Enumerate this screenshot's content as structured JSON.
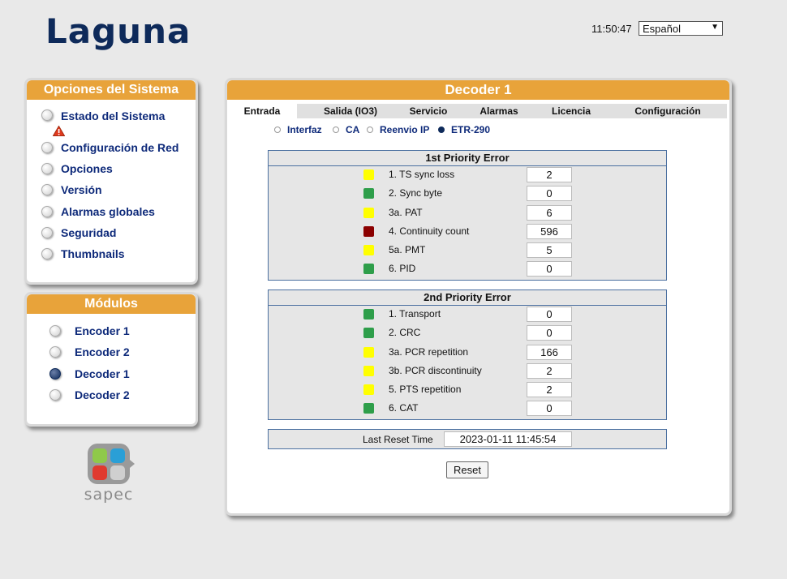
{
  "header": {
    "brand": "Laguna",
    "clock": "11:50:47",
    "language": "Español"
  },
  "system_panel": {
    "title": "Opciones del Sistema",
    "items": [
      {
        "label": "Estado del Sistema",
        "warning": true
      },
      {
        "label": "Configuración de Red"
      },
      {
        "label": "Opciones"
      },
      {
        "label": "Versión"
      },
      {
        "label": "Alarmas globales"
      },
      {
        "label": "Seguridad"
      },
      {
        "label": "Thumbnails"
      }
    ]
  },
  "modules_panel": {
    "title": "Módulos",
    "items": [
      {
        "label": "Encoder 1",
        "selected": false
      },
      {
        "label": "Encoder 2",
        "selected": false
      },
      {
        "label": "Decoder 1",
        "selected": true
      },
      {
        "label": "Decoder 2",
        "selected": false
      }
    ]
  },
  "main": {
    "title": "Decoder 1",
    "tabs": [
      "Entrada",
      "Salida (IO3)",
      "Servicio",
      "Alarmas",
      "Licencia",
      "Configuración"
    ],
    "active_tab": "Entrada",
    "subtabs": [
      "Interfaz",
      "CA",
      "Reenvio IP",
      "ETR-290"
    ],
    "active_subtab": "ETR-290",
    "first_priority": {
      "title": "1st Priority Error",
      "rows": [
        {
          "label": "1. TS sync loss",
          "value": "2",
          "status": "yellow"
        },
        {
          "label": "2. Sync byte",
          "value": "0",
          "status": "green"
        },
        {
          "label": "3a. PAT",
          "value": "6",
          "status": "yellow"
        },
        {
          "label": "4. Continuity count",
          "value": "596",
          "status": "red"
        },
        {
          "label": "5a. PMT",
          "value": "5",
          "status": "yellow"
        },
        {
          "label": "6. PID",
          "value": "0",
          "status": "green"
        }
      ]
    },
    "second_priority": {
      "title": "2nd Priority Error",
      "rows": [
        {
          "label": "1. Transport",
          "value": "0",
          "status": "green"
        },
        {
          "label": "2. CRC",
          "value": "0",
          "status": "green"
        },
        {
          "label": "3a. PCR repetition",
          "value": "166",
          "status": "yellow"
        },
        {
          "label": "3b. PCR discontinuity",
          "value": "2",
          "status": "yellow"
        },
        {
          "label": "5. PTS repetition",
          "value": "2",
          "status": "yellow"
        },
        {
          "label": "6. CAT",
          "value": "0",
          "status": "green"
        }
      ]
    },
    "last_reset_label": "Last Reset Time",
    "last_reset_value": "2023-01-11 11:45:54",
    "reset_button": "Reset"
  },
  "footer_logo": "sapec",
  "colors": {
    "accent": "#e8a33a",
    "nav_text": "#0e2a7a",
    "yellow": "#ffff00",
    "green": "#2e9e4a",
    "red": "#8b0000"
  }
}
